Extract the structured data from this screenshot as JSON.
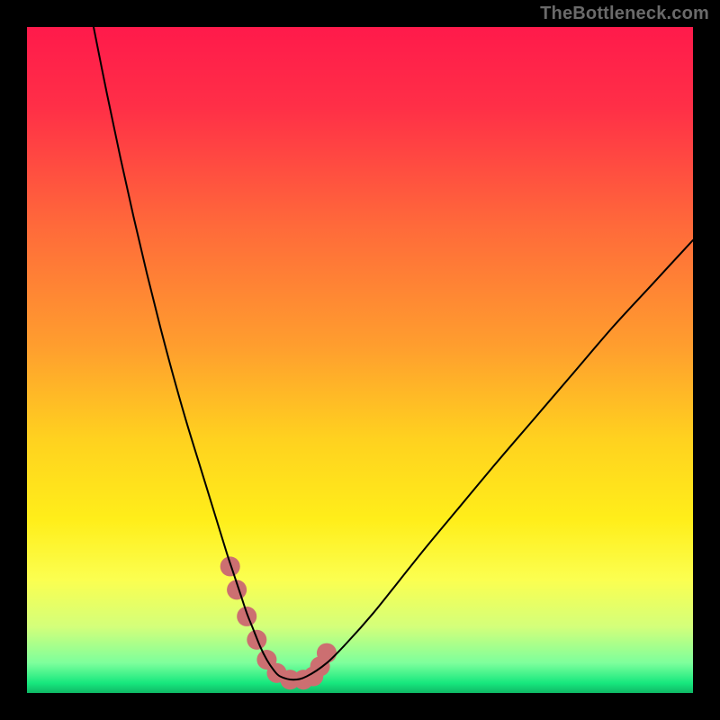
{
  "watermark": "TheBottleneck.com",
  "chart_data": {
    "type": "line",
    "title": "",
    "xlabel": "",
    "ylabel": "",
    "xlim": [
      0,
      100
    ],
    "ylim": [
      0,
      100
    ],
    "grid": false,
    "legend": false,
    "background_gradient_stops": [
      {
        "offset": 0.0,
        "color": "#ff1a4b"
      },
      {
        "offset": 0.12,
        "color": "#ff2f47"
      },
      {
        "offset": 0.3,
        "color": "#ff6a3a"
      },
      {
        "offset": 0.48,
        "color": "#ff9e2e"
      },
      {
        "offset": 0.62,
        "color": "#ffd21f"
      },
      {
        "offset": 0.74,
        "color": "#ffee1a"
      },
      {
        "offset": 0.83,
        "color": "#fbff50"
      },
      {
        "offset": 0.9,
        "color": "#d4ff7a"
      },
      {
        "offset": 0.955,
        "color": "#7dff9c"
      },
      {
        "offset": 0.985,
        "color": "#17e87e"
      },
      {
        "offset": 1.0,
        "color": "#0fb865"
      }
    ],
    "series": [
      {
        "name": "bottleneck-curve",
        "color": "#000000",
        "stroke_width": 2,
        "x": [
          10,
          12,
          14,
          16,
          18,
          20,
          22,
          24,
          26,
          28,
          30,
          31,
          32,
          33,
          34,
          35,
          36,
          37,
          38,
          40,
          42,
          45,
          48,
          52,
          56,
          60,
          65,
          70,
          76,
          82,
          88,
          94,
          100
        ],
        "values": [
          100,
          90,
          80.5,
          71.5,
          63,
          55,
          47.5,
          40.5,
          34,
          27.5,
          21,
          18,
          15,
          12,
          9.5,
          7,
          5,
          3.5,
          2.5,
          2,
          2.5,
          4.5,
          7.5,
          12,
          17,
          22,
          28,
          34,
          41,
          48,
          55,
          61.5,
          68
        ]
      }
    ],
    "markers": {
      "name": "highlight-points",
      "color": "#cc6f71",
      "radius": 11,
      "x": [
        30.5,
        31.5,
        33,
        34.5,
        36,
        37.5,
        39.5,
        41.5,
        43,
        44,
        45
      ],
      "values": [
        19,
        15.5,
        11.5,
        8,
        5,
        3,
        2,
        2,
        2.5,
        4,
        6
      ]
    }
  }
}
